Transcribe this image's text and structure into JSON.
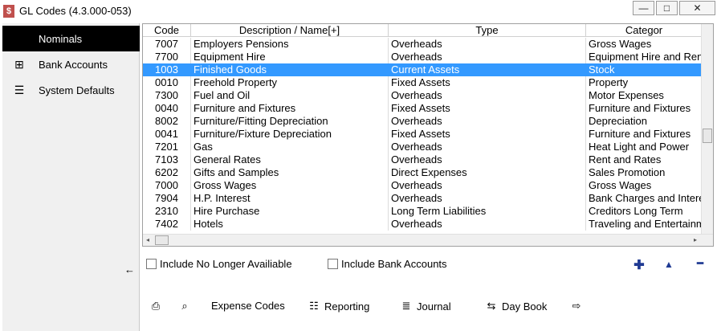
{
  "window": {
    "app_icon": "$",
    "title": "GL Codes (4.3.000-053)",
    "min": "—",
    "restore": "□",
    "close": "✕"
  },
  "sidebar": {
    "items": [
      {
        "label": "Nominals",
        "icon": ""
      },
      {
        "label": "Bank Accounts",
        "icon": "⊞"
      },
      {
        "label": "System Defaults",
        "icon": "☰"
      }
    ],
    "back": "←"
  },
  "grid": {
    "headers": [
      "Code",
      "Description / Name[+]",
      "Type",
      "Categor"
    ],
    "rows": [
      {
        "code": "7007",
        "desc": "Employers Pensions",
        "type": "Overheads",
        "cat": "Gross Wages"
      },
      {
        "code": "7700",
        "desc": "Equipment Hire",
        "type": "Overheads",
        "cat": "Equipment Hire and Rent"
      },
      {
        "code": "1003",
        "desc": "Finished Goods",
        "type": "Current Assets",
        "cat": "Stock"
      },
      {
        "code": "0010",
        "desc": "Freehold Property",
        "type": "Fixed Assets",
        "cat": "Property"
      },
      {
        "code": "7300",
        "desc": "Fuel and Oil",
        "type": "Overheads",
        "cat": "Motor Expenses"
      },
      {
        "code": "0040",
        "desc": "Furniture and Fixtures",
        "type": "Fixed Assets",
        "cat": "Furniture and Fixtures"
      },
      {
        "code": "8002",
        "desc": "Furniture/Fitting Depreciation",
        "type": "Overheads",
        "cat": "Depreciation"
      },
      {
        "code": "0041",
        "desc": "Furniture/Fixture Depreciation",
        "type": "Fixed Assets",
        "cat": "Furniture and Fixtures"
      },
      {
        "code": "7201",
        "desc": "Gas",
        "type": "Overheads",
        "cat": "Heat Light and Power"
      },
      {
        "code": "7103",
        "desc": "General Rates",
        "type": "Overheads",
        "cat": "Rent and Rates"
      },
      {
        "code": "6202",
        "desc": "Gifts and Samples",
        "type": "Direct Expenses",
        "cat": "Sales Promotion"
      },
      {
        "code": "7000",
        "desc": "Gross Wages",
        "type": "Overheads",
        "cat": "Gross Wages"
      },
      {
        "code": "7904",
        "desc": "H.P. Interest",
        "type": "Overheads",
        "cat": "Bank Charges and Intere"
      },
      {
        "code": "2310",
        "desc": "Hire Purchase",
        "type": "Long Term Liabilities",
        "cat": "Creditors Long Term"
      },
      {
        "code": "7402",
        "desc": "Hotels",
        "type": "Overheads",
        "cat": "Traveling and Entertainm"
      }
    ],
    "selected_index": 2,
    "scroll_left": "◂",
    "scroll_right": "▸"
  },
  "options": {
    "include_no_longer": "Include No Longer Availiable",
    "include_bank": "Include Bank Accounts",
    "add": "✚",
    "up": "▲",
    "remove": "━"
  },
  "toolbar": {
    "expense_codes": "Expense Codes",
    "reporting": "Reporting",
    "journal": "Journal",
    "day_book": "Day Book",
    "print_glyph": "⎙",
    "zoom_glyph": "⌕",
    "reporting_glyph": "☷",
    "journal_glyph": "≣",
    "daybook_glyph": "⇆",
    "export_glyph": "⇨"
  },
  "colors": {
    "selection": "#3399ff",
    "active_nav": "#000000",
    "action_icon": "#1f3a93"
  }
}
